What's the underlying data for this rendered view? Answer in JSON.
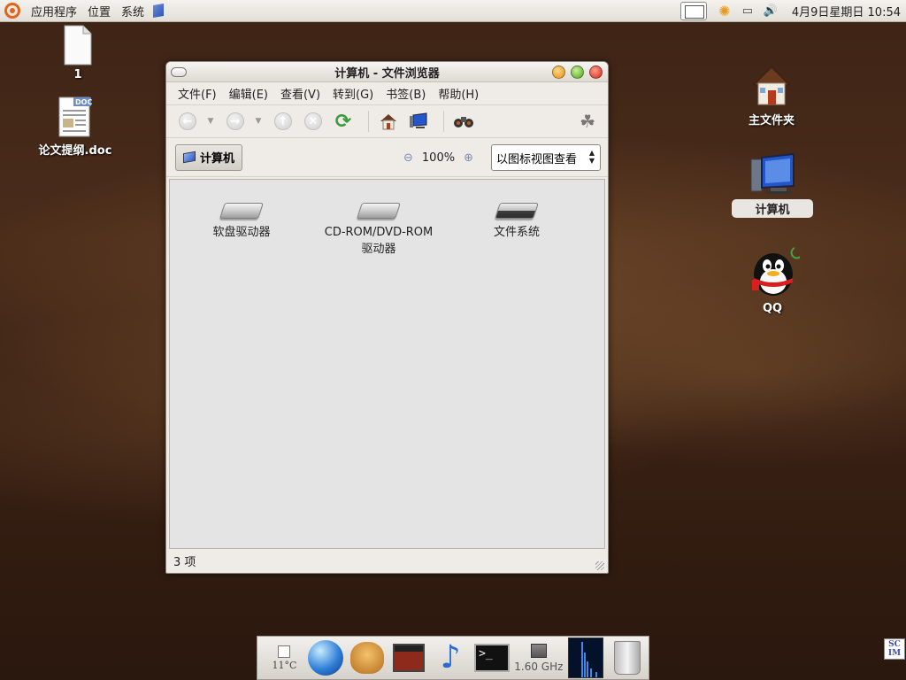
{
  "top_panel": {
    "menus": [
      "应用程序",
      "位置",
      "系统"
    ],
    "clock": "4月9日星期日 10:54"
  },
  "desktop": {
    "icons": [
      {
        "label": "1"
      },
      {
        "label": "论文提纲.doc"
      },
      {
        "label": "主文件夹"
      },
      {
        "label": "计算机"
      },
      {
        "label": "QQ"
      }
    ]
  },
  "window": {
    "title": "计算机 - 文件浏览器",
    "menubar": [
      "文件(F)",
      "编辑(E)",
      "查看(V)",
      "转到(G)",
      "书签(B)",
      "帮助(H)"
    ],
    "location_button": "计算机",
    "zoom": "100%",
    "view_mode": "以图标视图查看",
    "items": [
      {
        "label": "软盘驱动器",
        "icon": "floppy-drive-icon"
      },
      {
        "label": "CD-ROM/DVD-ROM\n驱动器",
        "icon": "cdrom-drive-icon"
      },
      {
        "label": "文件系统",
        "icon": "filesystem-drive-icon"
      }
    ],
    "status": "3 项"
  },
  "dock": {
    "temperature": "11°C",
    "cpu_freq": "1.60 GHz"
  },
  "tray": {
    "input_method": "SC\nIM"
  }
}
